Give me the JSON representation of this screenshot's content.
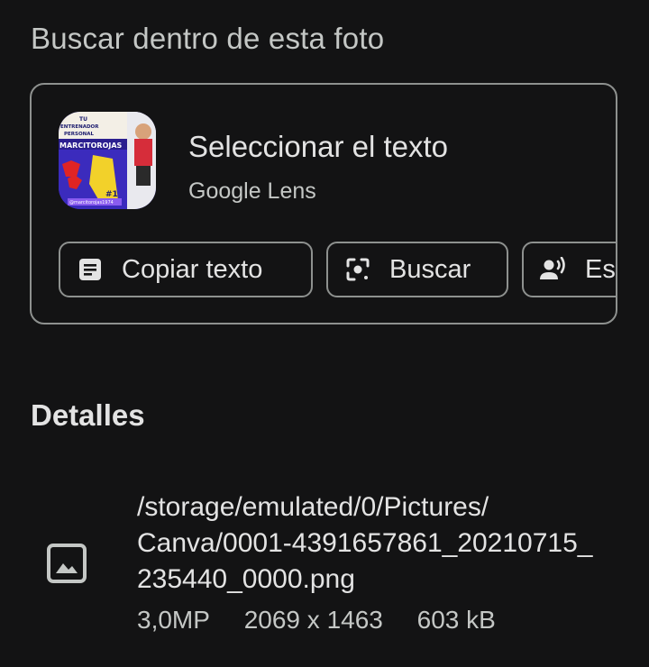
{
  "search_section": {
    "title": "Buscar dentro de esta foto"
  },
  "lens_card": {
    "title": "Seleccionar el texto",
    "subtitle": "Google Lens",
    "thumbnail": {
      "texts": [
        "TU",
        "ENTRENADOR",
        "PERSONAL",
        "MARCITOROJAS",
        "#1",
        "@marcitorojas1974"
      ]
    },
    "actions": [
      {
        "label": "Copiar texto",
        "icon": "document-icon"
      },
      {
        "label": "Buscar",
        "icon": "lens-search-icon"
      },
      {
        "label": "Escuchar",
        "icon": "read-aloud-icon"
      }
    ]
  },
  "details": {
    "title": "Detalles",
    "path_lines": [
      "/storage/emulated/0/Pictures/",
      "Canva/0001-4391657861_20210715_",
      "235440_0000.png"
    ],
    "resolution": "3,0MP",
    "dimensions": "2069 x 1463",
    "size": "603 kB"
  },
  "colors": {
    "background": "#131314",
    "outline": "#8e918f",
    "primary_text": "#e3e3e3",
    "secondary_text": "#c4c7c5"
  }
}
